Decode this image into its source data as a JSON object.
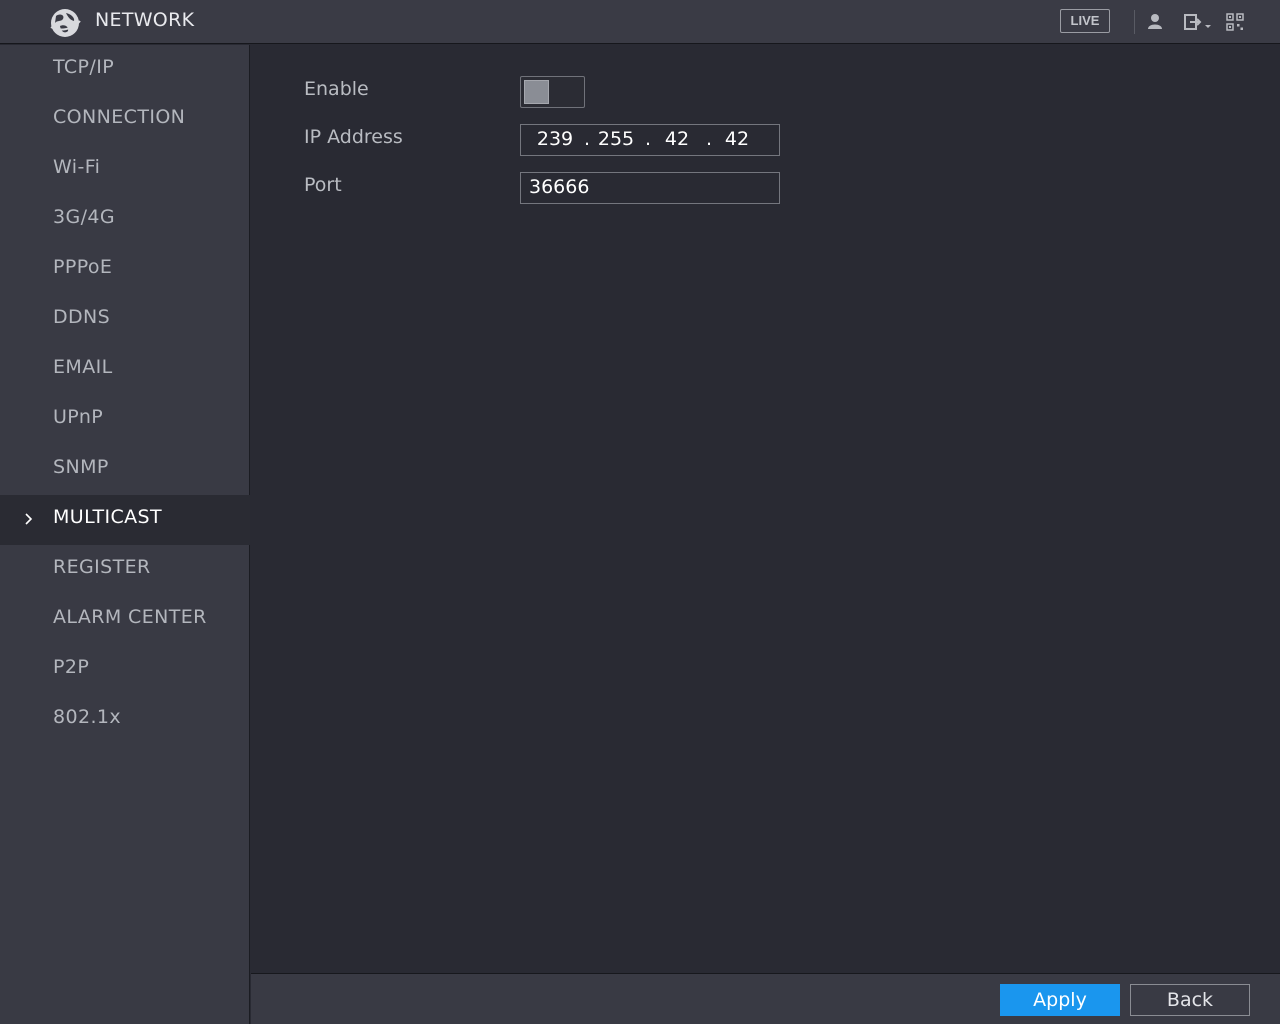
{
  "header": {
    "title": "NETWORK",
    "live_label": "LIVE",
    "logo_icon": "globe-logo-icon",
    "icons": [
      "user-icon",
      "logout-icon",
      "qr-code-icon"
    ]
  },
  "sidebar": {
    "items": [
      {
        "label": "TCP/IP"
      },
      {
        "label": "CONNECTION"
      },
      {
        "label": "Wi-Fi"
      },
      {
        "label": "3G/4G"
      },
      {
        "label": "PPPoE"
      },
      {
        "label": "DDNS"
      },
      {
        "label": "EMAIL"
      },
      {
        "label": "UPnP"
      },
      {
        "label": "SNMP"
      },
      {
        "label": "MULTICAST",
        "active": true
      },
      {
        "label": "REGISTER"
      },
      {
        "label": "ALARM CENTER"
      },
      {
        "label": "P2P"
      },
      {
        "label": "802.1x"
      }
    ]
  },
  "form": {
    "enable_label": "Enable",
    "enable_value": false,
    "ip_label": "IP Address",
    "ip_octets": [
      "239",
      "255",
      "42",
      "42"
    ],
    "port_label": "Port",
    "port_value": "36666"
  },
  "footer": {
    "apply_label": "Apply",
    "back_label": "Back"
  },
  "colors": {
    "accent": "#1a96ee",
    "background": "#292a33",
    "sidebar": "#393a44"
  }
}
